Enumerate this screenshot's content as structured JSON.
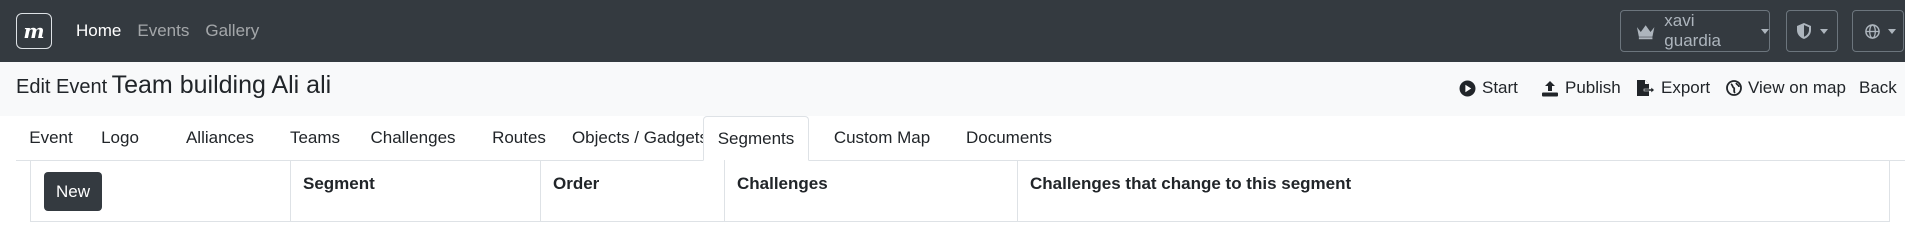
{
  "navbar": {
    "brand_letter": "m",
    "links": [
      {
        "label": "Home",
        "active": true
      },
      {
        "label": "Events",
        "active": false
      },
      {
        "label": "Gallery",
        "active": false
      }
    ],
    "user_name": "xavi guardia"
  },
  "header": {
    "title_prefix": "Edit Event",
    "event_name": "Team building Ali ali",
    "actions": {
      "start": "Start",
      "publish": "Publish",
      "export": "Export",
      "view_on_map": "View on map",
      "back": "Back"
    }
  },
  "tabs": [
    {
      "label": "Event",
      "active": false
    },
    {
      "label": "Logo",
      "active": false
    },
    {
      "label": "Alliances",
      "active": false
    },
    {
      "label": "Teams",
      "active": false
    },
    {
      "label": "Challenges",
      "active": false
    },
    {
      "label": "Routes",
      "active": false
    },
    {
      "label": "Objects / Gadgets",
      "active": false
    },
    {
      "label": "Segments",
      "active": true
    },
    {
      "label": "Custom Map",
      "active": false
    },
    {
      "label": "Documents",
      "active": false
    }
  ],
  "table": {
    "new_button": "New",
    "columns": [
      "Segment",
      "Order",
      "Challenges",
      "Challenges that change to this segment"
    ],
    "rows": []
  },
  "colors": {
    "navbar_bg": "#343a40",
    "header_bg": "#f8f9fa",
    "button_dark": "#343a40"
  }
}
